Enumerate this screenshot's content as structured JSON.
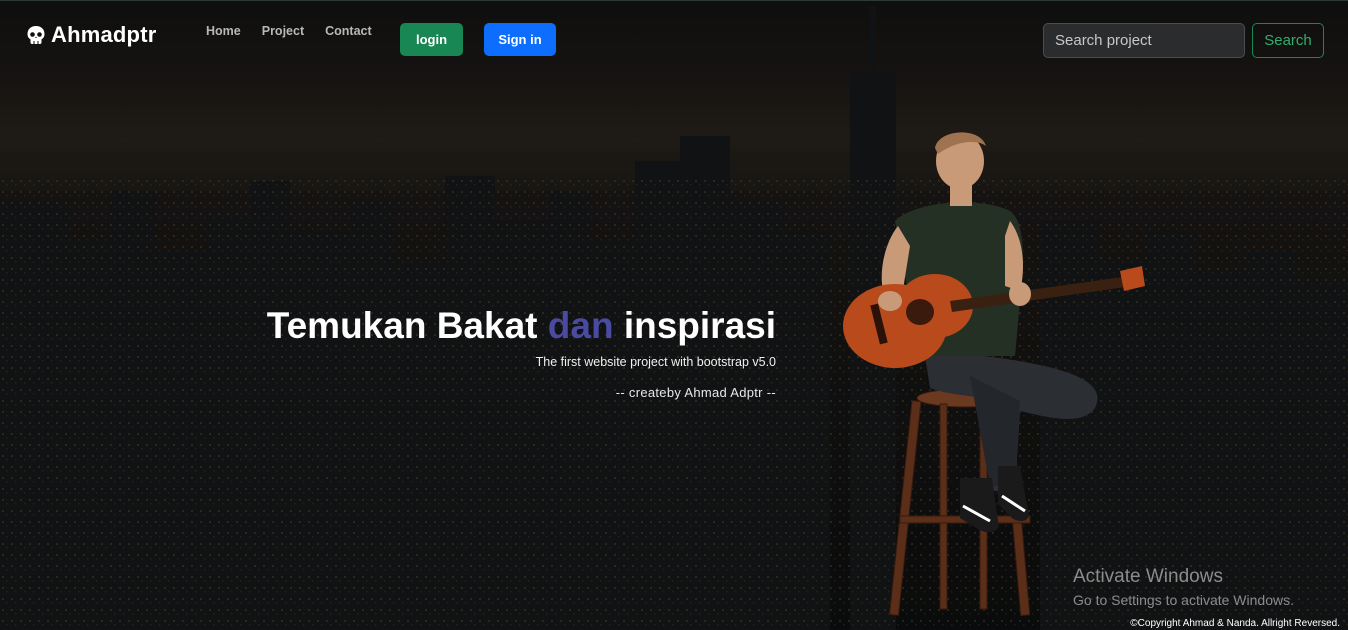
{
  "navbar": {
    "brand": "Ahmadptr",
    "links": [
      "Home",
      "Project",
      "Contact"
    ],
    "login_label": "login",
    "signin_label": "Sign in",
    "search_placeholder": "Search project",
    "search_button": "Search"
  },
  "hero": {
    "title_part1": "Temukan Bakat ",
    "title_accent": "dan",
    "title_part2": " inspirasi",
    "subtitle": "The first website project with bootstrap v5.0",
    "credit": "-- createby Ahmad Adptr --"
  },
  "watermark": {
    "line1": "Activate Windows",
    "line2": "Go to Settings to activate Windows."
  },
  "footer": {
    "copyright": "©Copyright Ahmad & Nanda. Allright Reversed."
  },
  "colors": {
    "login_bg": "#198754",
    "signin_bg": "#0d6efd",
    "search_outline": "#198754",
    "accent_text": "#4a4aa0"
  },
  "icons": {
    "brand_icon": "skull-icon"
  }
}
